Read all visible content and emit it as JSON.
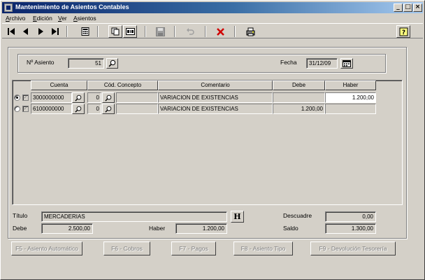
{
  "window": {
    "title": "Mantenimiento de Asientos Contables"
  },
  "menu": [
    {
      "label": "Archivo",
      "key": "A",
      "rest": "rchivo"
    },
    {
      "label": "Edición",
      "key": "E",
      "rest": "dición"
    },
    {
      "label": "Ver",
      "key": "V",
      "rest": "er"
    },
    {
      "label": "Asientos",
      "key": "A",
      "rest": "sientos"
    }
  ],
  "toolbar_icons": [
    "first-record-icon",
    "previous-record-icon",
    "next-record-icon",
    "last-record-icon",
    "calculator-icon",
    "copy-icon",
    "export-icon",
    "save-icon",
    "undo-icon",
    "delete-icon",
    "print-icon",
    "help-icon"
  ],
  "header": {
    "asiento_label": "Nº Asiento",
    "asiento_value": "51",
    "fecha_label": "Fecha",
    "fecha_value": "31/12/09"
  },
  "grid": {
    "columns": [
      "Cuenta",
      "Cód. Concepto",
      "Comentario",
      "Debe",
      "Haber"
    ],
    "rows": [
      {
        "selected": true,
        "checked": true,
        "cuenta": "3000000000",
        "codigo": "0",
        "concepto": "",
        "comentario": "VARIACION DE EXISTENCIAS",
        "debe": "",
        "haber": "1.200,00"
      },
      {
        "selected": false,
        "checked": true,
        "cuenta": "6100000000",
        "codigo": "0",
        "concepto": "",
        "comentario": "VARIACION DE EXISTENCIAS",
        "debe": "1.200,00",
        "haber": ""
      }
    ]
  },
  "footer": {
    "titulo_label": "Título",
    "titulo_value": "MERCADERIAS",
    "h_button": "H",
    "descuadre_label": "Descuadre",
    "descuadre_value": "0,00",
    "debe_label": "Debe",
    "debe_value": "2.500,00",
    "haber_label": "Haber",
    "haber_value": "1.200,00",
    "saldo_label": "Saldo",
    "saldo_value": "1.300,00"
  },
  "function_keys": [
    "F5 - Asiento Automático",
    "F6 - Cobros",
    "F7 - Pagos",
    "F8 - Asiento Tipo",
    "F9 - Devolución Tesorería"
  ]
}
